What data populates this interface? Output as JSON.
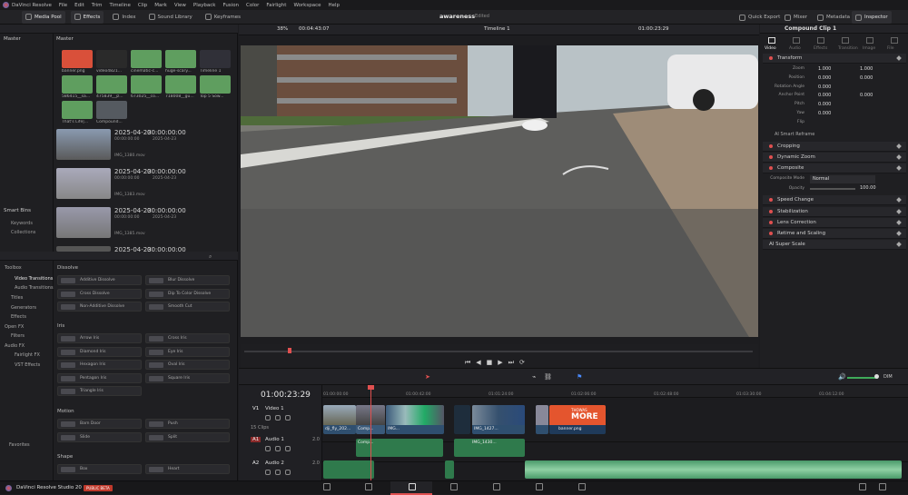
{
  "menubar": {
    "items": [
      "DaVinci Resolve",
      "File",
      "Edit",
      "Trim",
      "Timeline",
      "Clip",
      "Mark",
      "View",
      "Playback",
      "Fusion",
      "Color",
      "Fairlight",
      "Workspace",
      "Help"
    ],
    "project_name": "awareness",
    "project_status": "Edited"
  },
  "toolbar": {
    "left": [
      "Media Pool",
      "Effects",
      "Index",
      "Sound Library",
      "Keyframes"
    ],
    "right": [
      "Quick Export",
      "Mixer",
      "Metadata",
      "Inspector"
    ]
  },
  "viewer": {
    "zoom": "38%",
    "duration": "00:04:43:07",
    "timeline_name": "Timeline 1",
    "timecode": "01:00:23:29"
  },
  "media_pool": {
    "bin_header": "Master",
    "tree_header": "Master",
    "smart_bins_header": "Smart Bins",
    "smart_bins": [
      "Keywords",
      "Collections"
    ],
    "thumbs": [
      {
        "label": "banner.png",
        "color": "#d9503a"
      },
      {
        "label": "video4821...",
        "color": "#2a2a2a"
      },
      {
        "label": "cinematic-c...",
        "color": "#5f9e5f"
      },
      {
        "label": "huge-scary...",
        "color": "#5f9e5f"
      },
      {
        "label": "Timeline 1",
        "color": "#303038"
      },
      {
        "label": "586415__sa...",
        "color": "#5f9e5f"
      },
      {
        "label": "475839__jz...",
        "color": "#5f9e5f"
      },
      {
        "label": "673025__co...",
        "color": "#5f9e5f"
      },
      {
        "label": "718008__gu...",
        "color": "#5f9e5f"
      },
      {
        "label": "Top 5 Sow...",
        "color": "#5f9e5f"
      },
      {
        "label": "That's Life|...",
        "color": "#5f9e5f"
      },
      {
        "label": "Compound...",
        "color": "#555a60"
      }
    ],
    "clips": [
      {
        "date": "2025-04-23",
        "tc": "00:00:00:00",
        "tc2": "00:00:00:00",
        "date2": "2025-04-23",
        "name": "IMG_1380.mov"
      },
      {
        "date": "2025-04-23",
        "tc": "00:00:00:00",
        "tc2": "00:00:00:00",
        "date2": "2025-04-23",
        "name": "IMG_1383.mov"
      },
      {
        "date": "2025-04-23",
        "tc": "00:00:00:00",
        "tc2": "00:00:00:00",
        "date2": "2025-04-23",
        "name": "IMG_1385.mov"
      },
      {
        "date": "2025-04-23",
        "tc": "00:00:00:00",
        "tc2": "",
        "date2": "",
        "name": ""
      }
    ]
  },
  "effects": {
    "tree": [
      "Toolbox",
      "Video Transitions",
      "Audio Transitions",
      "Titles",
      "Generators",
      "Effects",
      "Open FX",
      "Filters",
      "Audio FX",
      "Fairlight FX",
      "VST Effects"
    ],
    "favorites": "Favorites",
    "sections": [
      {
        "title": "Dissolve",
        "items": [
          "Additive Dissolve",
          "Blur Dissolve",
          "Cross Dissolve",
          "Dip To Color Dissolve",
          "Non-Additive Dissolve",
          "Smooth Cut"
        ]
      },
      {
        "title": "Iris",
        "items": [
          "Arrow Iris",
          "Cross Iris",
          "Diamond Iris",
          "Eye Iris",
          "Hexagon Iris",
          "Oval Iris",
          "Pentagon Iris",
          "Square Iris",
          "Triangle Iris"
        ]
      },
      {
        "title": "Motion",
        "items": [
          "Barn Door",
          "Push",
          "Slide",
          "Split"
        ]
      },
      {
        "title": "Shape",
        "items": [
          "Box",
          "Heart"
        ]
      }
    ]
  },
  "inspector": {
    "title": "Compound Clip 1",
    "tabs": [
      "Video",
      "Audio",
      "Effects",
      "Transition",
      "Image",
      "File"
    ],
    "transform_label": "Transform",
    "params": [
      {
        "label": "Zoom",
        "x": "1.000",
        "y": "1.000"
      },
      {
        "label": "Position",
        "x": "0.000",
        "y": "0.000"
      },
      {
        "label": "Rotation Angle",
        "x": "0.000",
        "y": ""
      },
      {
        "label": "Anchor Point",
        "x": "0.000",
        "y": "0.000"
      },
      {
        "label": "Pitch",
        "x": "0.000",
        "y": ""
      },
      {
        "label": "Yaw",
        "x": "0.000",
        "y": ""
      },
      {
        "label": "Flip",
        "x": "",
        "y": ""
      }
    ],
    "ai_reframe": "AI Smart Reframe",
    "sections": [
      "Cropping",
      "Dynamic Zoom",
      "Composite"
    ],
    "composite_mode_label": "Composite Mode",
    "composite_mode": "Normal",
    "opacity_label": "Opacity",
    "opacity": "100.00",
    "sections2": [
      "Speed Change",
      "Stabilization",
      "Lens Correction",
      "Retime and Scaling",
      "AI Super Scale"
    ]
  },
  "timeline": {
    "timecode": "01:00:23:29",
    "ruler": [
      "01:00:00:00",
      "01:00:42:00",
      "01:01:24:00",
      "01:02:06:00",
      "01:02:48:00",
      "01:03:30:00",
      "01:04:12:00"
    ],
    "tracks": [
      {
        "id": "V1",
        "name": "Video 1",
        "info": "15 Clips"
      },
      {
        "id": "A1",
        "name": "Audio 1",
        "info": "2.0"
      },
      {
        "id": "A2",
        "name": "Audio 2",
        "info": "2.0"
      }
    ],
    "video_clips": [
      "dji_fly_202...",
      "Comp...",
      "IMG...",
      "IMG_1427...",
      "IMG...",
      "banner.png"
    ],
    "audio_clips": [
      "Comp...",
      "IMG...",
      "IMG_1430..."
    ],
    "banner_text": "MORE",
    "banner_sub": "THOWAS"
  },
  "status": {
    "app_name": "DaVinci Resolve Studio 20",
    "badge": "PUBLIC BETA"
  }
}
